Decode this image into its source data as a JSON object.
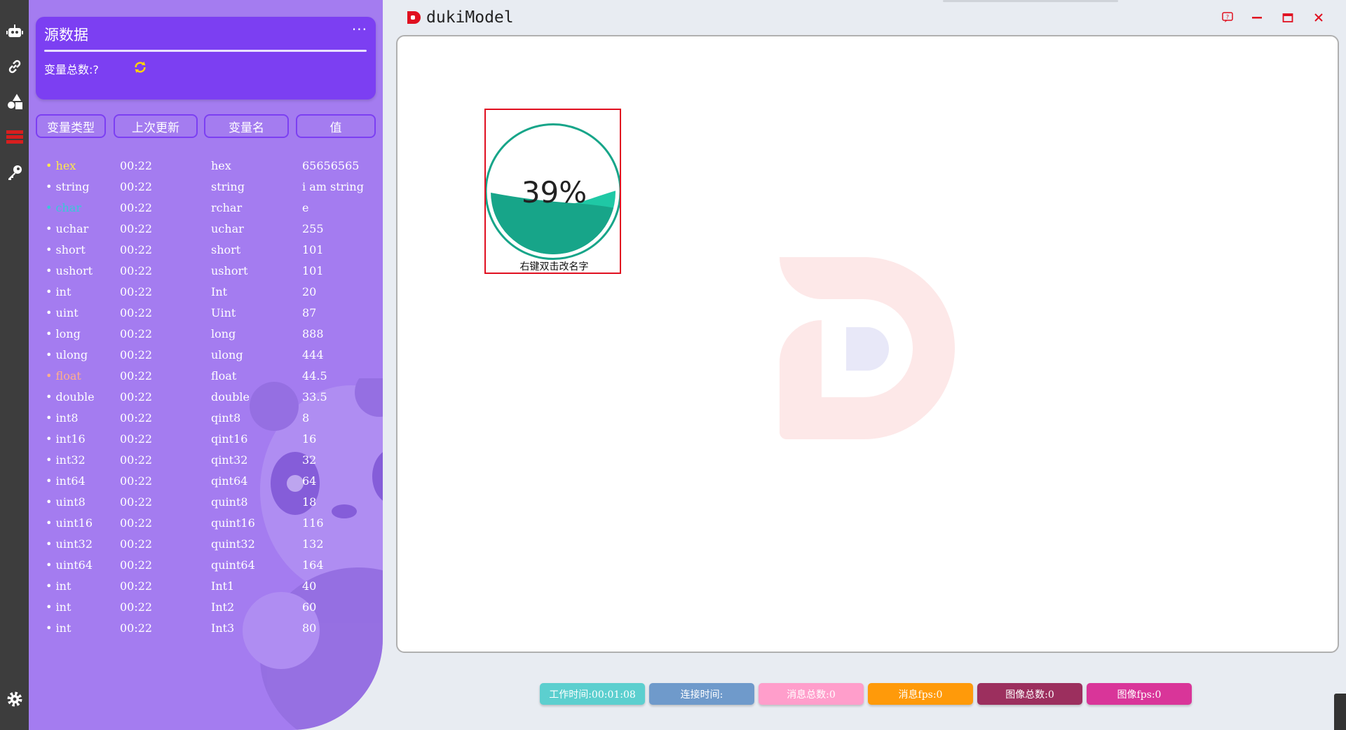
{
  "app": {
    "title": "dukiModel"
  },
  "rail": {
    "icons": [
      "robot-icon",
      "link-icon",
      "shapes-icon",
      "database-icon",
      "key-icon",
      "settings-icon"
    ]
  },
  "panel": {
    "title": "源数据",
    "more": "···",
    "count_label": "变量总数:?",
    "columns": [
      "变量类型",
      "上次更新",
      "变量名",
      "值"
    ],
    "rows": [
      {
        "type": "• hex",
        "time": "00:22",
        "name": "hex",
        "value": "65656565",
        "color": "#ffe94a"
      },
      {
        "type": "• string",
        "time": "00:22",
        "name": "string",
        "value": "i am string",
        "color": "#ffffff"
      },
      {
        "type": "• char",
        "time": "00:22",
        "name": "rchar",
        "value": "e",
        "color": "#38c8d8"
      },
      {
        "type": "• uchar",
        "time": "00:22",
        "name": "uchar",
        "value": "255",
        "color": "#ffffff"
      },
      {
        "type": "• short",
        "time": "00:22",
        "name": "short",
        "value": "101",
        "color": "#ffffff"
      },
      {
        "type": "• ushort",
        "time": "00:22",
        "name": "ushort",
        "value": "101",
        "color": "#ffffff"
      },
      {
        "type": "• int",
        "time": "00:22",
        "name": "Int",
        "value": "20",
        "color": "#ffffff"
      },
      {
        "type": "• uint",
        "time": "00:22",
        "name": "Uint",
        "value": "87",
        "color": "#ffffff"
      },
      {
        "type": "• long",
        "time": "00:22",
        "name": "long",
        "value": "888",
        "color": "#ffffff"
      },
      {
        "type": "• ulong",
        "time": "00:22",
        "name": "ulong",
        "value": "444",
        "color": "#ffffff"
      },
      {
        "type": "• float",
        "time": "00:22",
        "name": "float",
        "value": "44.5",
        "color": "#ffb08a"
      },
      {
        "type": "• double",
        "time": "00:22",
        "name": "double",
        "value": "33.5",
        "color": "#ffffff"
      },
      {
        "type": "• int8",
        "time": "00:22",
        "name": "qint8",
        "value": "8",
        "color": "#ffffff"
      },
      {
        "type": "• int16",
        "time": "00:22",
        "name": "qint16",
        "value": "16",
        "color": "#ffffff"
      },
      {
        "type": "• int32",
        "time": "00:22",
        "name": "qint32",
        "value": "32",
        "color": "#ffffff"
      },
      {
        "type": "• int64",
        "time": "00:22",
        "name": "qint64",
        "value": "64",
        "color": "#ffffff"
      },
      {
        "type": "• uint8",
        "time": "00:22",
        "name": "quint8",
        "value": "18",
        "color": "#ffffff"
      },
      {
        "type": "• uint16",
        "time": "00:22",
        "name": "quint16",
        "value": "116",
        "color": "#ffffff"
      },
      {
        "type": "• uint32",
        "time": "00:22",
        "name": "quint32",
        "value": "132",
        "color": "#ffffff"
      },
      {
        "type": "• uint64",
        "time": "00:22",
        "name": "quint64",
        "value": "164",
        "color": "#ffffff"
      },
      {
        "type": "• int",
        "time": "00:22",
        "name": "Int1",
        "value": "40",
        "color": "#ffffff"
      },
      {
        "type": "• int",
        "time": "00:22",
        "name": "Int2",
        "value": "60",
        "color": "#ffffff"
      },
      {
        "type": "• int",
        "time": "00:22",
        "name": "Int3",
        "value": "80",
        "color": "#ffffff"
      }
    ]
  },
  "widget": {
    "percent_text": "39%",
    "level": 0.39,
    "caption": "右键双击改名字"
  },
  "status": [
    {
      "label": "工作时间:00:01:08",
      "color": "#5ccfcf"
    },
    {
      "label": "连接时间:",
      "color": "#6f9acb"
    },
    {
      "label": "消息总数:0",
      "color": "#ff9ecb"
    },
    {
      "label": "消息fps:0",
      "color": "#ff9a0a"
    },
    {
      "label": "图像总数:0",
      "color": "#9c2f5e"
    },
    {
      "label": "图像fps:0",
      "color": "#d93599"
    }
  ],
  "colors": {
    "accent": "#7c3ff2",
    "panel": "#a47cf0",
    "wave": "#17a589"
  }
}
